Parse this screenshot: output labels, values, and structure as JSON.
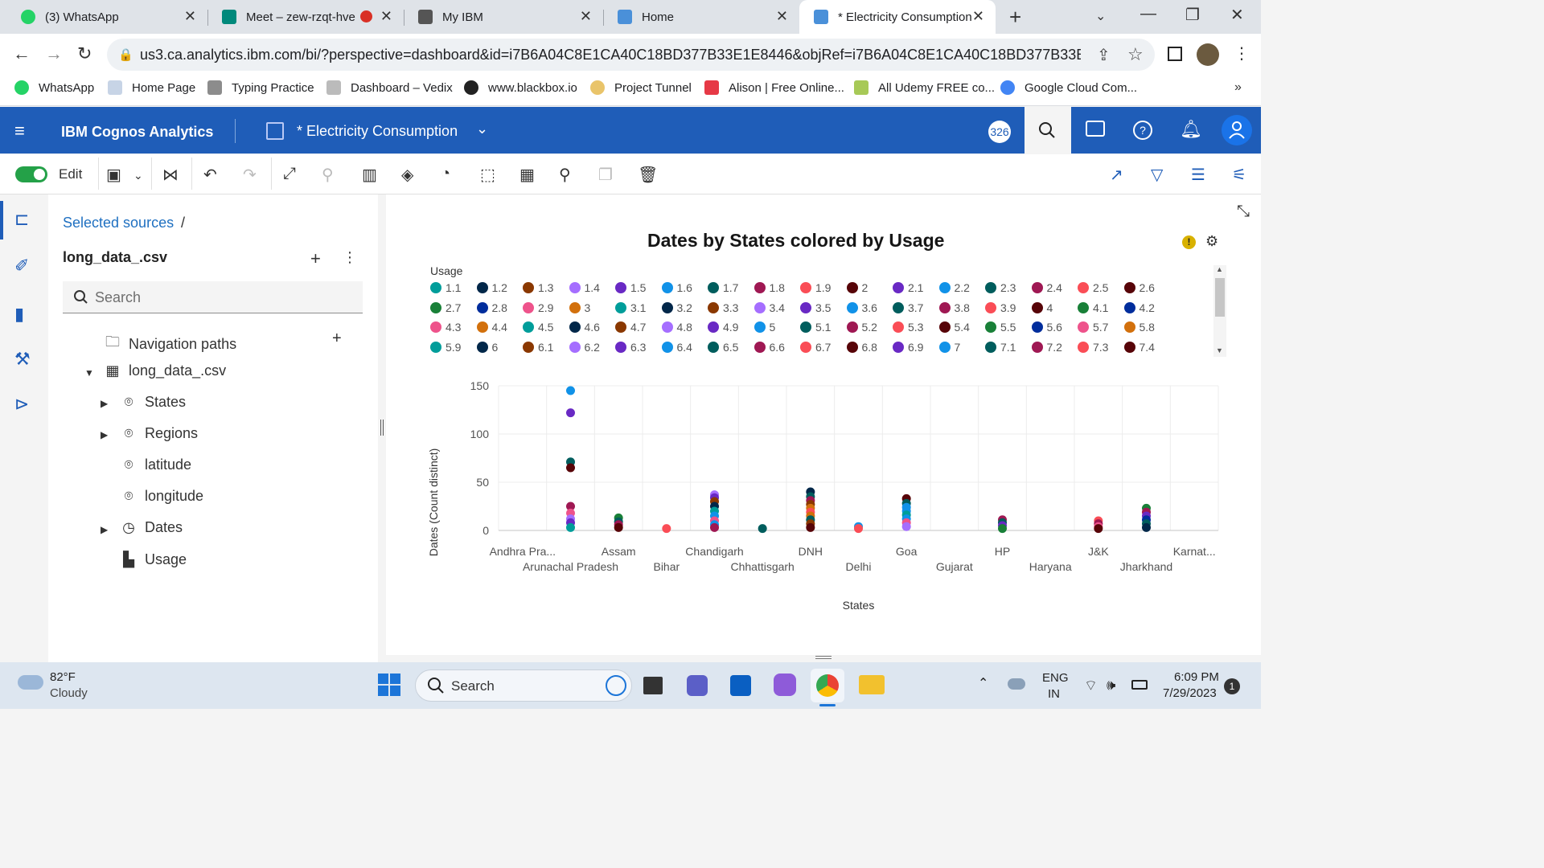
{
  "browser": {
    "tabs": [
      {
        "label": "(3) WhatsApp",
        "color": "#25d366"
      },
      {
        "label": "Meet – zew-rzqt-hve",
        "color": "#00897b"
      },
      {
        "label": "My IBM",
        "color": "#555555"
      },
      {
        "label": "Home",
        "color": "#4a90d9"
      },
      {
        "label": "* Electricity Consumption",
        "color": "#4a90d9"
      }
    ],
    "url": "us3.ca.analytics.ibm.com/bi/?perspective=dashboard&id=i7B6A04C8E1CA40C18BD377B33E1E8446&objRef=i7B6A04C8E1CA40C18BD377B33E1E8446&o...",
    "bookmarks": [
      "WhatsApp",
      "Home Page",
      "Typing Practice",
      "Dashboard – Vedix",
      "www.blackbox.io",
      "Project Tunnel",
      "Alison | Free Online...",
      "All Udemy FREE co...",
      "Google Cloud Com..."
    ]
  },
  "cognos": {
    "app_title": "IBM Cognos Analytics",
    "dashboard_title": "* Electricity Consumption",
    "badge": "326",
    "edit_label": "Edit",
    "accent": "#1f5db8"
  },
  "panel": {
    "breadcrumb": "Selected sources",
    "breadcrumb_sep": "/",
    "source": "long_data_.csv",
    "search_placeholder": "Search",
    "nav_paths": "Navigation paths",
    "table": "long_data_.csv",
    "fields": [
      "States",
      "Regions",
      "latitude",
      "longitude",
      "Dates",
      "Usage"
    ]
  },
  "chart_data": {
    "type": "scatter",
    "title": "Dates by States colored by Usage",
    "xlabel": "States",
    "ylabel": "Dates (Count distinct)",
    "ylim": [
      0,
      150
    ],
    "yticks": [
      0,
      50,
      100,
      150
    ],
    "legend_title": "Usage",
    "legend_position": "top",
    "legend": [
      {
        "label": "1.1",
        "color": "#009d9a"
      },
      {
        "label": "1.2",
        "color": "#012749"
      },
      {
        "label": "1.3",
        "color": "#8a3800"
      },
      {
        "label": "1.4",
        "color": "#a56eff"
      },
      {
        "label": "1.5",
        "color": "#6929c4"
      },
      {
        "label": "1.6",
        "color": "#1192e8"
      },
      {
        "label": "1.7",
        "color": "#005d5d"
      },
      {
        "label": "1.8",
        "color": "#9f1853"
      },
      {
        "label": "1.9",
        "color": "#fa4d56"
      },
      {
        "label": "2",
        "color": "#570408"
      },
      {
        "label": "2.1",
        "color": "#6929c4"
      },
      {
        "label": "2.2",
        "color": "#1192e8"
      },
      {
        "label": "2.3",
        "color": "#005d5d"
      },
      {
        "label": "2.4",
        "color": "#9f1853"
      },
      {
        "label": "2.5",
        "color": "#fa4d56"
      },
      {
        "label": "2.6",
        "color": "#570408"
      },
      {
        "label": "2.7",
        "color": "#198038"
      },
      {
        "label": "2.8",
        "color": "#002d9c"
      },
      {
        "label": "2.9",
        "color": "#ee538b"
      },
      {
        "label": "3",
        "color": "#d2700c"
      },
      {
        "label": "3.1",
        "color": "#009d9a"
      },
      {
        "label": "3.2",
        "color": "#012749"
      },
      {
        "label": "3.3",
        "color": "#8a3800"
      },
      {
        "label": "3.4",
        "color": "#a56eff"
      },
      {
        "label": "3.5",
        "color": "#6929c4"
      },
      {
        "label": "3.6",
        "color": "#1192e8"
      },
      {
        "label": "3.7",
        "color": "#005d5d"
      },
      {
        "label": "3.8",
        "color": "#9f1853"
      },
      {
        "label": "3.9",
        "color": "#fa4d56"
      },
      {
        "label": "4",
        "color": "#570408"
      },
      {
        "label": "4.1",
        "color": "#198038"
      },
      {
        "label": "4.2",
        "color": "#002d9c"
      },
      {
        "label": "4.3",
        "color": "#ee538b"
      },
      {
        "label": "4.4",
        "color": "#d2700c"
      },
      {
        "label": "4.5",
        "color": "#009d9a"
      },
      {
        "label": "4.6",
        "color": "#012749"
      },
      {
        "label": "4.7",
        "color": "#8a3800"
      },
      {
        "label": "4.8",
        "color": "#a56eff"
      },
      {
        "label": "4.9",
        "color": "#6929c4"
      },
      {
        "label": "5",
        "color": "#1192e8"
      },
      {
        "label": "5.1",
        "color": "#005d5d"
      },
      {
        "label": "5.2",
        "color": "#9f1853"
      },
      {
        "label": "5.3",
        "color": "#fa4d56"
      },
      {
        "label": "5.4",
        "color": "#570408"
      },
      {
        "label": "5.5",
        "color": "#198038"
      },
      {
        "label": "5.6",
        "color": "#002d9c"
      },
      {
        "label": "5.7",
        "color": "#ee538b"
      },
      {
        "label": "5.8",
        "color": "#d2700c"
      },
      {
        "label": "5.9",
        "color": "#009d9a"
      },
      {
        "label": "6",
        "color": "#012749"
      },
      {
        "label": "6.1",
        "color": "#8a3800"
      },
      {
        "label": "6.2",
        "color": "#a56eff"
      },
      {
        "label": "6.3",
        "color": "#6929c4"
      },
      {
        "label": "6.4",
        "color": "#1192e8"
      },
      {
        "label": "6.5",
        "color": "#005d5d"
      },
      {
        "label": "6.6",
        "color": "#9f1853"
      },
      {
        "label": "6.7",
        "color": "#fa4d56"
      },
      {
        "label": "6.8",
        "color": "#570408"
      },
      {
        "label": "6.9",
        "color": "#6929c4"
      },
      {
        "label": "7",
        "color": "#1192e8"
      },
      {
        "label": "7.1",
        "color": "#005d5d"
      },
      {
        "label": "7.2",
        "color": "#9f1853"
      },
      {
        "label": "7.3",
        "color": "#fa4d56"
      },
      {
        "label": "7.4",
        "color": "#570408"
      }
    ],
    "categories": [
      "Andhra Pra...",
      "Arunachal Pradesh",
      "Assam",
      "Bihar",
      "Chandigarh",
      "Chhattisgarh",
      "DNH",
      "Delhi",
      "Goa",
      "Gujarat",
      "HP",
      "Haryana",
      "J&K",
      "Jharkhand",
      "Karnat..."
    ],
    "points": [
      {
        "x": "Arunachal Pradesh",
        "y": 145,
        "color": "#1192e8"
      },
      {
        "x": "Arunachal Pradesh",
        "y": 122,
        "color": "#6929c4"
      },
      {
        "x": "Arunachal Pradesh",
        "y": 71,
        "color": "#005d5d"
      },
      {
        "x": "Arunachal Pradesh",
        "y": 65,
        "color": "#570408"
      },
      {
        "x": "Arunachal Pradesh",
        "y": 25,
        "color": "#9f1853"
      },
      {
        "x": "Arunachal Pradesh",
        "y": 18,
        "color": "#ee538b"
      },
      {
        "x": "Arunachal Pradesh",
        "y": 12,
        "color": "#a56eff"
      },
      {
        "x": "Arunachal Pradesh",
        "y": 8,
        "color": "#6929c4"
      },
      {
        "x": "Arunachal Pradesh",
        "y": 3,
        "color": "#009d9a"
      },
      {
        "x": "Assam",
        "y": 13,
        "color": "#198038"
      },
      {
        "x": "Assam",
        "y": 9,
        "color": "#005d5d"
      },
      {
        "x": "Assam",
        "y": 6,
        "color": "#9f1853"
      },
      {
        "x": "Assam",
        "y": 3,
        "color": "#570408"
      },
      {
        "x": "Bihar",
        "y": 2,
        "color": "#fa4d56"
      },
      {
        "x": "Chandigarh",
        "y": 37,
        "color": "#a56eff"
      },
      {
        "x": "Chandigarh",
        "y": 34,
        "color": "#6929c4"
      },
      {
        "x": "Chandigarh",
        "y": 30,
        "color": "#8a3800"
      },
      {
        "x": "Chandigarh",
        "y": 25,
        "color": "#012749"
      },
      {
        "x": "Chandigarh",
        "y": 20,
        "color": "#009d9a"
      },
      {
        "x": "Chandigarh",
        "y": 15,
        "color": "#1192e8"
      },
      {
        "x": "Chandigarh",
        "y": 10,
        "color": "#ee538b"
      },
      {
        "x": "Chandigarh",
        "y": 6,
        "color": "#1192e8"
      },
      {
        "x": "Chandigarh",
        "y": 3,
        "color": "#9f1853"
      },
      {
        "x": "Chhattisgarh",
        "y": 2,
        "color": "#005d5d"
      },
      {
        "x": "DNH",
        "y": 40,
        "color": "#012749"
      },
      {
        "x": "DNH",
        "y": 35,
        "color": "#005d5d"
      },
      {
        "x": "DNH",
        "y": 31,
        "color": "#9f1853"
      },
      {
        "x": "DNH",
        "y": 27,
        "color": "#8a3800"
      },
      {
        "x": "DNH",
        "y": 23,
        "color": "#d2700c"
      },
      {
        "x": "DNH",
        "y": 19,
        "color": "#fa4d56"
      },
      {
        "x": "DNH",
        "y": 15,
        "color": "#d2700c"
      },
      {
        "x": "DNH",
        "y": 11,
        "color": "#005d5d"
      },
      {
        "x": "DNH",
        "y": 7,
        "color": "#8a3800"
      },
      {
        "x": "DNH",
        "y": 3,
        "color": "#570408"
      },
      {
        "x": "Delhi",
        "y": 4,
        "color": "#1192e8"
      },
      {
        "x": "Delhi",
        "y": 2,
        "color": "#fa4d56"
      },
      {
        "x": "Goa",
        "y": 33,
        "color": "#570408"
      },
      {
        "x": "Goa",
        "y": 28,
        "color": "#005d5d"
      },
      {
        "x": "Goa",
        "y": 24,
        "color": "#1192e8"
      },
      {
        "x": "Goa",
        "y": 20,
        "color": "#1192e8"
      },
      {
        "x": "Goa",
        "y": 16,
        "color": "#009d9a"
      },
      {
        "x": "Goa",
        "y": 12,
        "color": "#1192e8"
      },
      {
        "x": "Goa",
        "y": 8,
        "color": "#ee538b"
      },
      {
        "x": "Goa",
        "y": 4,
        "color": "#a56eff"
      },
      {
        "x": "HP",
        "y": 11,
        "color": "#9f1853"
      },
      {
        "x": "HP",
        "y": 8,
        "color": "#005d5d"
      },
      {
        "x": "HP",
        "y": 5,
        "color": "#6929c4"
      },
      {
        "x": "HP",
        "y": 2,
        "color": "#198038"
      },
      {
        "x": "J&K",
        "y": 10,
        "color": "#fa4d56"
      },
      {
        "x": "J&K",
        "y": 7,
        "color": "#9f1853"
      },
      {
        "x": "J&K",
        "y": 4,
        "color": "#ee538b"
      },
      {
        "x": "J&K",
        "y": 2,
        "color": "#570408"
      },
      {
        "x": "Jharkhand",
        "y": 23,
        "color": "#198038"
      },
      {
        "x": "Jharkhand",
        "y": 19,
        "color": "#9f1853"
      },
      {
        "x": "Jharkhand",
        "y": 15,
        "color": "#6929c4"
      },
      {
        "x": "Jharkhand",
        "y": 11,
        "color": "#002d9c"
      },
      {
        "x": "Jharkhand",
        "y": 7,
        "color": "#005d5d"
      },
      {
        "x": "Jharkhand",
        "y": 3,
        "color": "#012749"
      }
    ]
  },
  "taskbar": {
    "weather_temp": "82°F",
    "weather_text": "Cloudy",
    "search_label": "Search",
    "lang1": "ENG",
    "lang2": "IN",
    "time": "6:09 PM",
    "date": "7/29/2023",
    "notif_count": "1"
  }
}
